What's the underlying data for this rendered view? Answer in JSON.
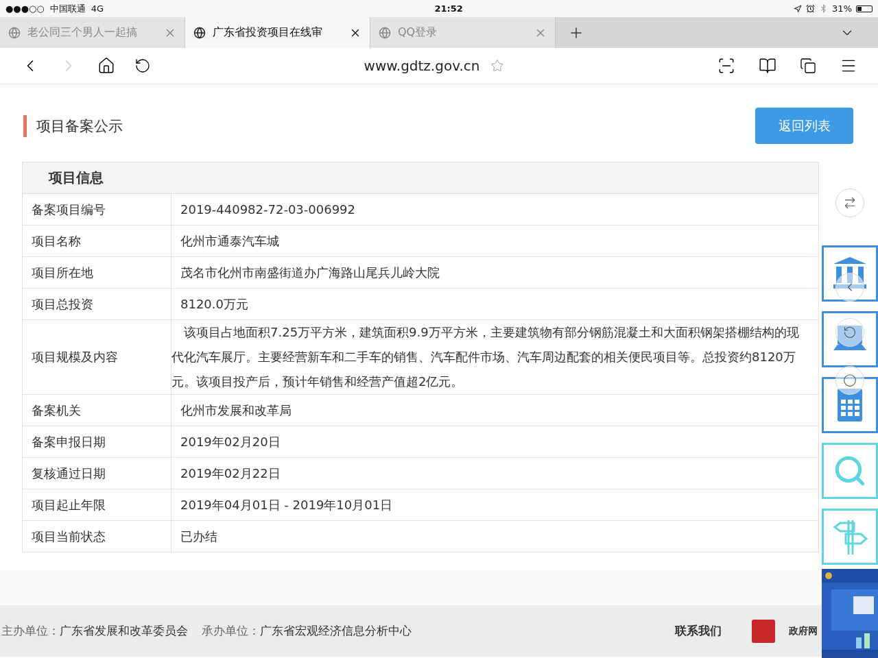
{
  "status_bar": {
    "signal": "●●●○○",
    "carrier": "中国联通",
    "network": "4G",
    "time": "21:52",
    "battery": "31%"
  },
  "tabs": [
    {
      "title": "老公同三个男人一起搞",
      "selected": false
    },
    {
      "title": "广东省投资项目在线审",
      "selected": true
    },
    {
      "title": "QQ登录",
      "selected": false
    }
  ],
  "address_bar": {
    "url": "www.gdtz.gov.cn"
  },
  "page": {
    "title": "项目备案公示",
    "back_button": "返回列表",
    "table": {
      "heading": "项目信息",
      "rows": [
        {
          "label": "备案项目编号",
          "value": "2019-440982-72-03-006992"
        },
        {
          "label": "项目名称",
          "value": "化州市通泰汽车城"
        },
        {
          "label": "项目所在地",
          "value": "茂名市化州市南盛街道办广海路山尾兵儿岭大院"
        },
        {
          "label": "项目总投资",
          "value": "8120.0万元"
        },
        {
          "label": "项目规模及内容",
          "value": "　该项目占地面积7.25万平方米，建筑面积9.9万平方米，主要建筑物有部分钢筋混凝土和大面积钢架搭棚结构的现代化汽车展厅。主要经营新车和二手车的销售、汽车配件市场、汽车周边配套的相关便民项目等。总投资约8120万元。该项目投产后，预计年销售和经营产值超2亿元。"
        },
        {
          "label": "备案机关",
          "value": "化州市发展和改革局"
        },
        {
          "label": "备案申报日期",
          "value": "2019年02月20日"
        },
        {
          "label": "复核通过日期",
          "value": "2019年02月22日"
        },
        {
          "label": "项目起止年限",
          "value": "2019年04月01日 - 2019年10月01日"
        },
        {
          "label": "项目当前状态",
          "value": "已办结"
        }
      ]
    }
  },
  "footer": {
    "sponsor_label": "主办单位：",
    "sponsor": "广东省发展和改革委员会",
    "organizer_label": "承办单位：",
    "organizer": "广东省宏观经济信息分析中心",
    "contact": "联系我们",
    "gov_site": "政府网"
  },
  "side_panel": {
    "items": [
      {
        "kind": "building",
        "color": "#3f8fdf"
      },
      {
        "kind": "laptop",
        "color": "#3f8fdf"
      },
      {
        "kind": "calculator",
        "color": "#3f8fdf"
      },
      {
        "kind": "search",
        "color": "#5fd6df"
      },
      {
        "kind": "signpost",
        "color": "#5fd6df"
      }
    ]
  }
}
